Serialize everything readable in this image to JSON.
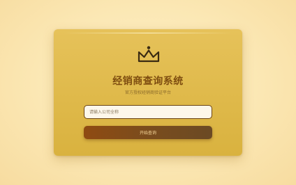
{
  "header": {
    "title": "经销商查询系统",
    "subtitle": "官方授权经销商验证平台",
    "logo_icon": "crown-icon"
  },
  "form": {
    "company_input": {
      "value": "",
      "placeholder": "请输入公司全称"
    },
    "submit_label": "开始查询"
  },
  "colors": {
    "page_background": "#fbe7b3",
    "card_background": "#dfb94a",
    "title_text": "#7e4d10",
    "button_background": "#7a4c1d",
    "button_text": "#f6d79a"
  }
}
